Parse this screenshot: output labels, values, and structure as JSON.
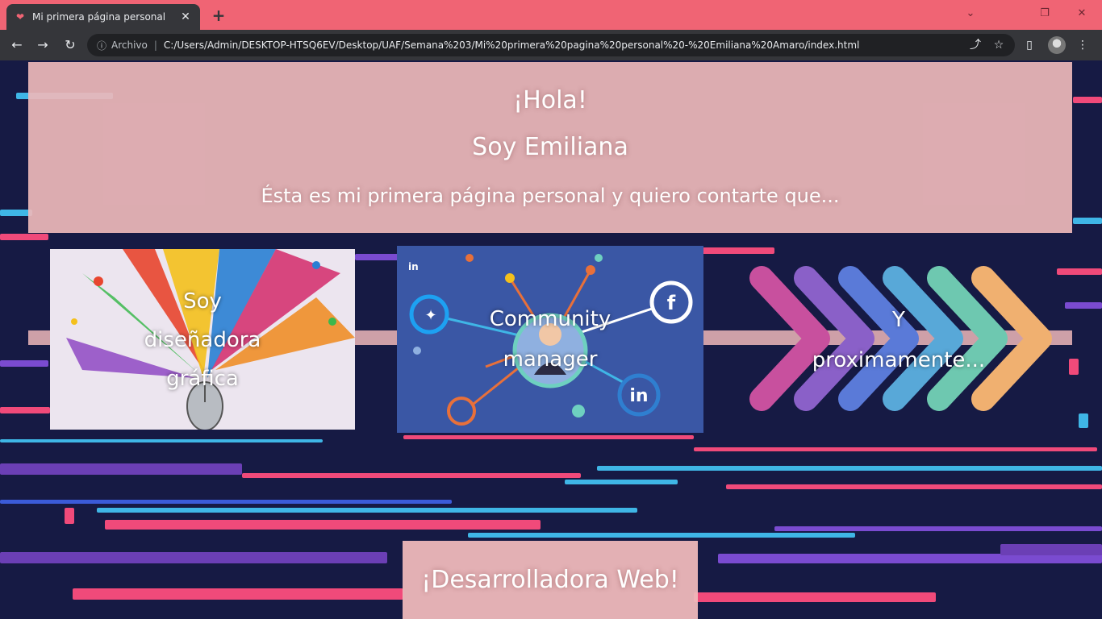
{
  "browser": {
    "tab_title": "Mi primera página personal",
    "tab_close": "✕",
    "new_tab": "+",
    "window_controls": {
      "minimize": "⌄",
      "restore": "❐",
      "close": "✕"
    },
    "nav": {
      "back": "←",
      "forward": "→",
      "reload": "↻"
    },
    "address": {
      "scheme_label": "Archivo",
      "separator": "|",
      "url": "C:/Users/Admin/DESKTOP-HTSQ6EV/Desktop/UAF/Semana%203/Mi%20primera%20pagina%20personal%20-%20Emiliana%20Amaro/index.html"
    }
  },
  "hero": {
    "greeting": "¡Hola!",
    "name": "Soy Emiliana",
    "intro": "Ésta es mi primera página personal y quiero contarte que..."
  },
  "cards": [
    {
      "caption_lines": [
        "Soy",
        "diseñadora",
        "gráfica"
      ]
    },
    {
      "caption_lines": [
        "Community",
        "manager"
      ]
    },
    {
      "caption_lines": [
        "Y",
        "proximamente..."
      ]
    }
  ],
  "footer": {
    "text": "¡Desarrolladora Web!"
  },
  "colors": {
    "tabbar": "#f06474",
    "chrome_dark": "#35363a",
    "panel_pink": "#eeb8ba",
    "page_bg": "#161a44",
    "social_blue": "#3a57a5"
  }
}
